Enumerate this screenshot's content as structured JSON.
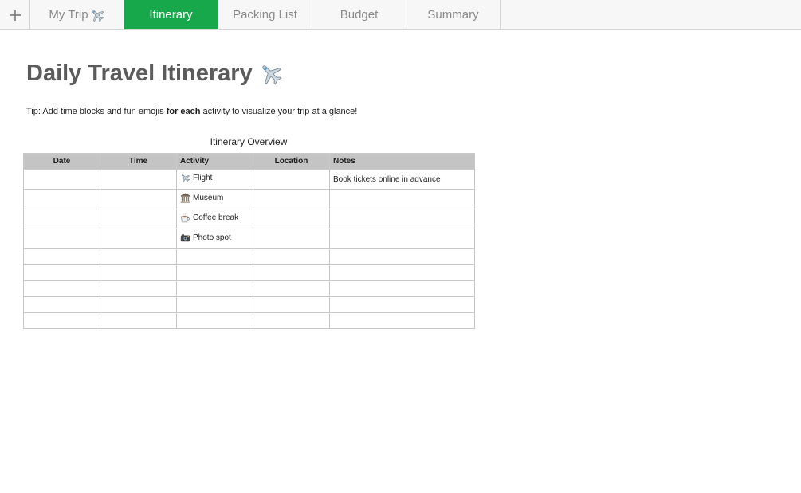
{
  "tabs": [
    {
      "label": "My Trip",
      "icon": "airplane-icon",
      "active": false
    },
    {
      "label": "Itinerary",
      "active": true
    },
    {
      "label": "Packing List",
      "active": false
    },
    {
      "label": "Budget",
      "active": false
    },
    {
      "label": "Summary",
      "active": false
    }
  ],
  "accent_color": "#17a84b",
  "sheet": {
    "title": "Daily Travel Itinerary",
    "title_icon": "airplane-icon",
    "tip_before": "Tip: Add time blocks and fun emojis ",
    "tip_bold": "for each",
    "tip_after": " activity to visualize your trip at a glance!",
    "table_title": "Itinerary Overview",
    "columns": [
      "Date",
      "Time",
      "Activity",
      "Location",
      "Notes"
    ],
    "rows": [
      {
        "date": "",
        "time": "",
        "activity": "Flight",
        "activity_icon": "airplane-icon",
        "location": "",
        "notes": "Book tickets online in advance"
      },
      {
        "date": "",
        "time": "",
        "activity": "Museum",
        "activity_icon": "museum-icon",
        "location": "",
        "notes": ""
      },
      {
        "date": "",
        "time": "",
        "activity": "Coffee break",
        "activity_icon": "coffee-icon",
        "location": "",
        "notes": ""
      },
      {
        "date": "",
        "time": "",
        "activity": "Photo spot",
        "activity_icon": "camera-icon",
        "location": "",
        "notes": ""
      }
    ]
  }
}
